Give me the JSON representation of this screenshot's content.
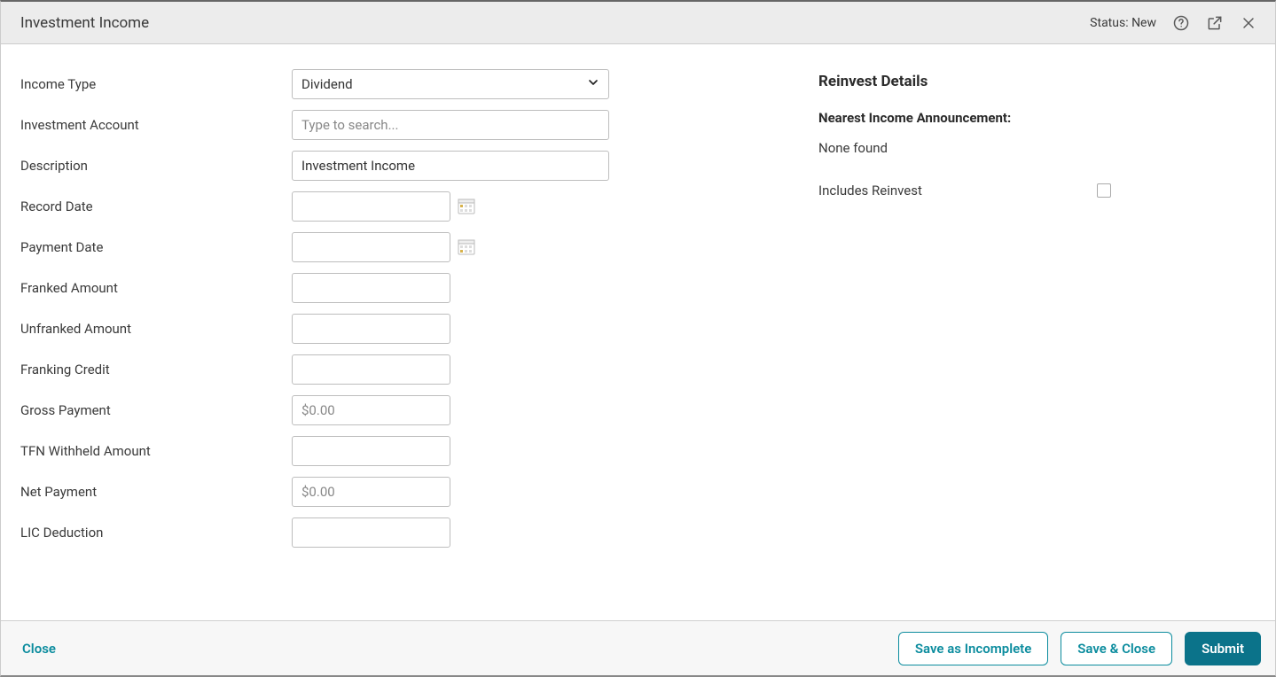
{
  "header": {
    "title": "Investment Income",
    "status_label": "Status: New"
  },
  "form": {
    "income_type": {
      "label": "Income Type",
      "value": "Dividend"
    },
    "investment_account": {
      "label": "Investment Account",
      "placeholder": "Type to search..."
    },
    "description": {
      "label": "Description",
      "value": "Investment Income"
    },
    "record_date": {
      "label": "Record Date",
      "value": ""
    },
    "payment_date": {
      "label": "Payment Date",
      "value": ""
    },
    "franked_amount": {
      "label": "Franked Amount",
      "value": ""
    },
    "unfranked_amount": {
      "label": "Unfranked Amount",
      "value": ""
    },
    "franking_credit": {
      "label": "Franking Credit",
      "value": ""
    },
    "gross_payment": {
      "label": "Gross Payment",
      "value": "$0.00"
    },
    "tfn_withheld": {
      "label": "TFN Withheld Amount",
      "value": ""
    },
    "net_payment": {
      "label": "Net Payment",
      "value": "$0.00"
    },
    "lic_deduction": {
      "label": "LIC Deduction",
      "value": ""
    }
  },
  "side": {
    "title": "Reinvest Details",
    "announcement_label": "Nearest Income Announcement:",
    "announcement_value": "None found",
    "includes_reinvest_label": "Includes Reinvest"
  },
  "footer": {
    "close": "Close",
    "save_incomplete": "Save as Incomplete",
    "save_close": "Save & Close",
    "submit": "Submit"
  }
}
